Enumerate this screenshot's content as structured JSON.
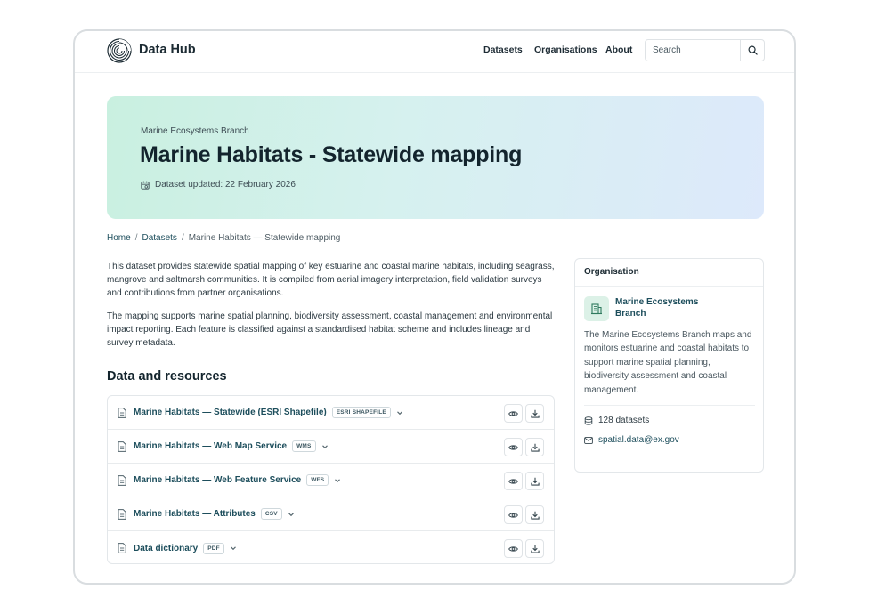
{
  "header": {
    "brand": "Data Hub",
    "nav": [
      "Datasets",
      "Organisations",
      "About"
    ],
    "search_placeholder": "Search"
  },
  "hero": {
    "branch": "Marine Ecosystems Branch",
    "title": "Marine Habitats - Statewide mapping",
    "updated": "Dataset updated: 22 February 2026"
  },
  "breadcrumb": {
    "home": "Home",
    "datasets": "Datasets",
    "current": "Marine Habitats — Statewide mapping",
    "separator": "/"
  },
  "description": [
    "This dataset provides statewide spatial mapping of key estuarine and coastal marine habitats, including seagrass, mangrove and saltmarsh communities. It is compiled from aerial imagery interpretation, field validation surveys and contributions from partner organisations.",
    "The mapping supports marine spatial planning, biodiversity assessment, coastal management and environmental impact reporting. Each feature is classified against a standardised habitat scheme and includes lineage and survey metadata."
  ],
  "resources": {
    "title": "Data and resources",
    "items": [
      {
        "title": "Marine Habitats — Statewide (ESRI Shapefile)",
        "format": "ESRI SHAPEFILE"
      },
      {
        "title": "Marine Habitats — Web Map Service",
        "format": "WMS"
      },
      {
        "title": "Marine Habitats — Web Feature Service",
        "format": "WFS"
      },
      {
        "title": "Marine Habitats — Attributes",
        "format": "CSV"
      },
      {
        "title": "Data dictionary",
        "format": "PDF"
      }
    ]
  },
  "organisation": {
    "heading": "Organisation",
    "name": "Marine Ecosystems Branch",
    "description": "The Marine Ecosystems Branch maps and monitors estuarine and coastal habitats to support marine spatial planning, biodiversity assessment and coastal management.",
    "datasets": "128 datasets",
    "email": "spatial.data@ex.gov"
  },
  "colors": {
    "accent": "#1d4e5c",
    "heading": "#13242d",
    "hero_start": "#c9f0e0",
    "hero_end": "#dde9fb"
  }
}
